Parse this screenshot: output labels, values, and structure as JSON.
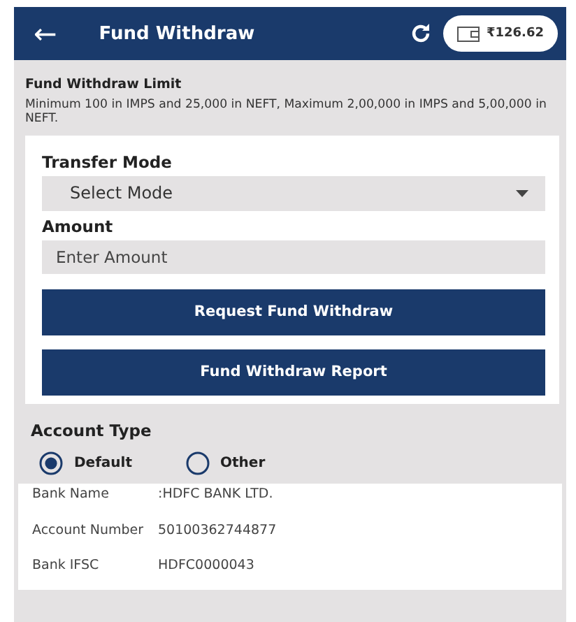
{
  "header": {
    "back": "←",
    "title": "Fund Withdraw",
    "balance": "₹126.62"
  },
  "limit": {
    "title": "Fund Withdraw Limit",
    "text": "Minimum 100 in IMPS and 25,000 in NEFT, Maximum 2,00,000 in IMPS and 5,00,000 in NEFT."
  },
  "form": {
    "transfer_label": "Transfer Mode",
    "transfer_value": "Select Mode",
    "amount_label": "Amount",
    "amount_placeholder": "Enter Amount"
  },
  "buttons": [
    "Request Fund Withdraw",
    "Fund Withdraw Report"
  ],
  "account_type": {
    "title": "Account Type",
    "options": [
      {
        "label": "Default",
        "selected": true
      },
      {
        "label": "Other",
        "selected": false
      }
    ]
  },
  "bank_details": [
    {
      "label": "Bank Name",
      "value": ":HDFC BANK LTD."
    },
    {
      "label": "Account Number",
      "value": "50100362744877"
    },
    {
      "label": "Bank IFSC",
      "value": "HDFC0000043"
    }
  ]
}
